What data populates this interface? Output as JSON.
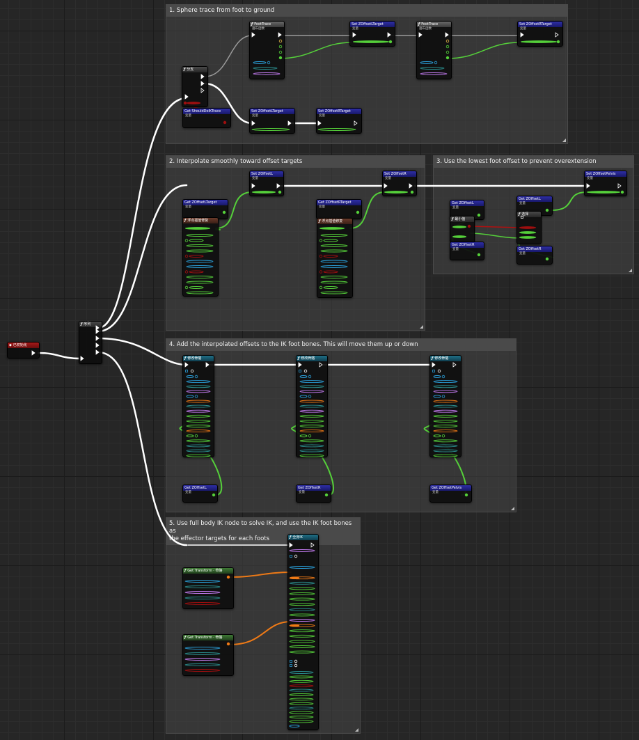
{
  "comments": {
    "c1": "1. Sphere trace from foot to ground",
    "c2": "2. Interpolate smoothly toward offset targets",
    "c3": "3. Use the lowest foot offset to prevent overextension",
    "c4": "4. Add the interpolated offsets to the IK foot bones. This will move them up or down",
    "c5a": "5. Use full body IK node to solve IK, and use the IK foot bones as",
    "c5b": "the effector targets for each foots"
  },
  "nodes": {
    "event": "已初始化",
    "sequence": "序列",
    "branch": "分支",
    "foot_trace_1": "FootTrace",
    "foot_trace_1_sub": "遍布函数",
    "foot_trace_2": "FootTrace",
    "foot_trace_2_sub": "遍布函数",
    "set_zl_target": "Set ZOffsetLTarget",
    "set_zr_target_top": "Set ZOffsetRTarget",
    "get_should_trace": "Get ShouldDoIKTrace",
    "set_zl_target_b": "Set ZOffsetLTarget",
    "set_zr_target_b": "Set ZOffsetRTarget",
    "set_zl": "Set ZOffsetL",
    "set_zr": "Set ZOffsetR",
    "get_zl_target": "Get ZOffsetLTarget",
    "get_zr_target": "Get ZOffsetRTarget",
    "interp_1": "浮点插值修复",
    "interp_2": "浮点插值修复",
    "set_pelvis": "Set ZOffsetPelvis",
    "get_zl_s3a": "Get ZOffsetL",
    "get_zr_s3a": "Get ZOffsetR",
    "min_node": "最小值",
    "get_zl_s3b": "Get ZOffsetL",
    "get_zr_s3b": "Get ZOffsetR",
    "select_node": "选择",
    "modify_1": "修改骨骼",
    "modify_2": "修改骨骼",
    "modify_3": "修改骨骼",
    "get_zl_s4": "Get ZOffsetL",
    "get_zr_s4": "Get ZOffsetR",
    "get_pelvis_s4": "Get ZOffsetPelvis",
    "full_body_ik": "全身IK",
    "get_transform_1": "Get Transform · 骨骼",
    "get_transform_2": "Get Transform · 骨骼",
    "var_sub": "变量"
  },
  "colors": {
    "exec": "#ffffff",
    "float": "#55d03a",
    "struct": "#2a9dd6",
    "vector": "#c17aee",
    "bool": "#9e0f0f",
    "transform": "#ef7a16",
    "select": "#e8b84a",
    "muted": "#2a8c8c"
  }
}
